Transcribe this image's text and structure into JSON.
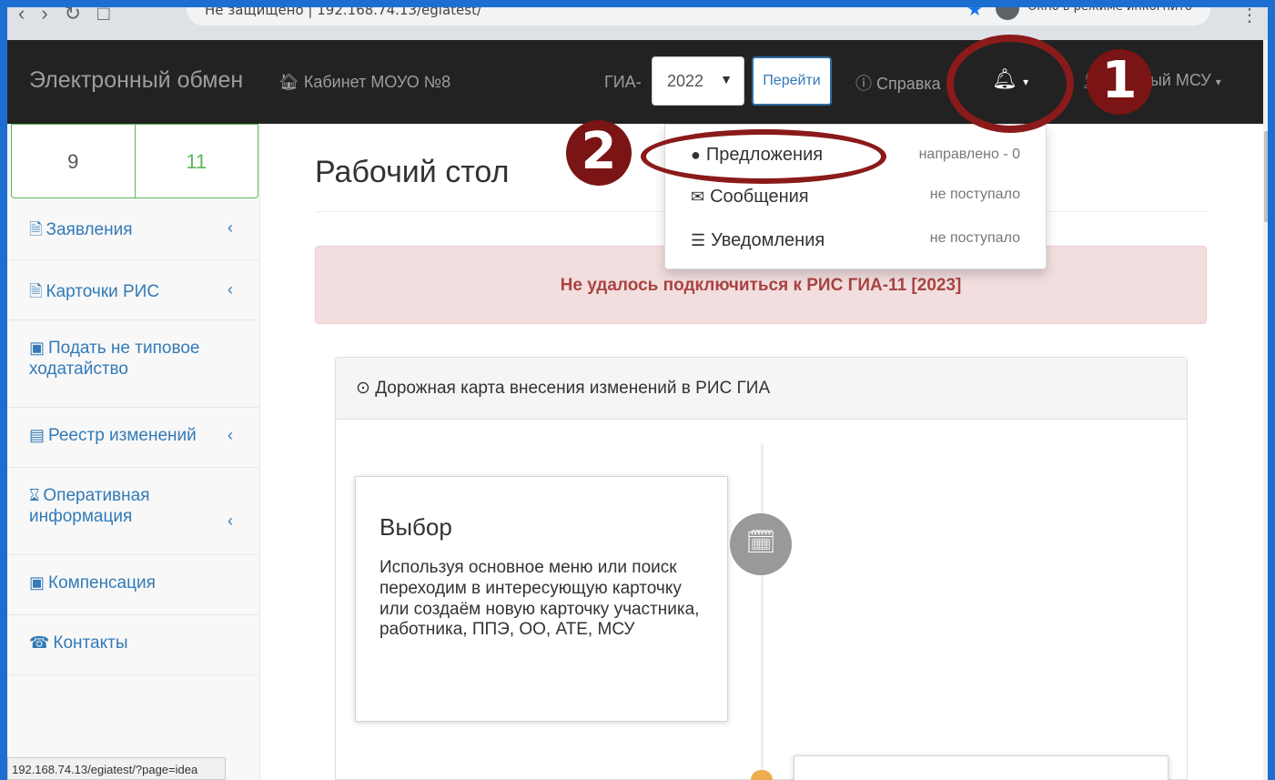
{
  "browser": {
    "address_text": "Не защищено | 192.168.74.13/egiatest/",
    "profile_text": "Окно в режиме инкогнито"
  },
  "navbar": {
    "brand": "Электронный обмен",
    "cabinet": "Кабинет МОУО №8",
    "gia_label": "ГИА-",
    "year": "2022",
    "go_button": "Перейти",
    "help": "Справка",
    "user_menu": "ый МСУ"
  },
  "sidebar": {
    "class_tabs": [
      "9",
      "11"
    ],
    "items": [
      {
        "label": "Заявления",
        "icon": "file-icon"
      },
      {
        "label": "Карточки РИС",
        "icon": "file-icon"
      },
      {
        "label": "Подать не типовое ходатайство",
        "icon": "document-frame-icon"
      },
      {
        "label": "Реестр изменений",
        "icon": "list-icon"
      },
      {
        "label": "Оперативная информация",
        "icon": "hourglass-icon"
      },
      {
        "label": "Компенсация",
        "icon": "money-icon"
      },
      {
        "label": "Контакты",
        "icon": "phone-icon"
      }
    ],
    "status_url": "192.168.74.13/egiatest/?page=idea"
  },
  "main": {
    "title": "Рабочий стол",
    "alert": "Не удалось подключиться к РИС ГИА-11 [2023]",
    "panel_heading": "Дорожная карта внесения изменений в РИС ГИА",
    "timeline_card": {
      "title": "Выбор",
      "text": "Используя основное меню или поиск переходим в интересующую карточку или создаём новую карточку участника, работника, ППЭ, ОО, АТЕ, МСУ"
    }
  },
  "dropdown": {
    "items": [
      {
        "label": "Предложения",
        "status": "направлено - 0",
        "icon": "apple-icon"
      },
      {
        "label": "Сообщения",
        "status": "не поступало",
        "icon": "envelope-icon"
      },
      {
        "label": "Уведомления",
        "status": "не поступало",
        "icon": "list-icon"
      }
    ]
  },
  "annotations": {
    "badge1": "1",
    "badge2": "2"
  },
  "colors": {
    "navbar": "#222222",
    "annotation": "#8b1a1a",
    "link": "#337ab7",
    "success": "#5cb85c",
    "alert_bg": "#f2dede"
  }
}
